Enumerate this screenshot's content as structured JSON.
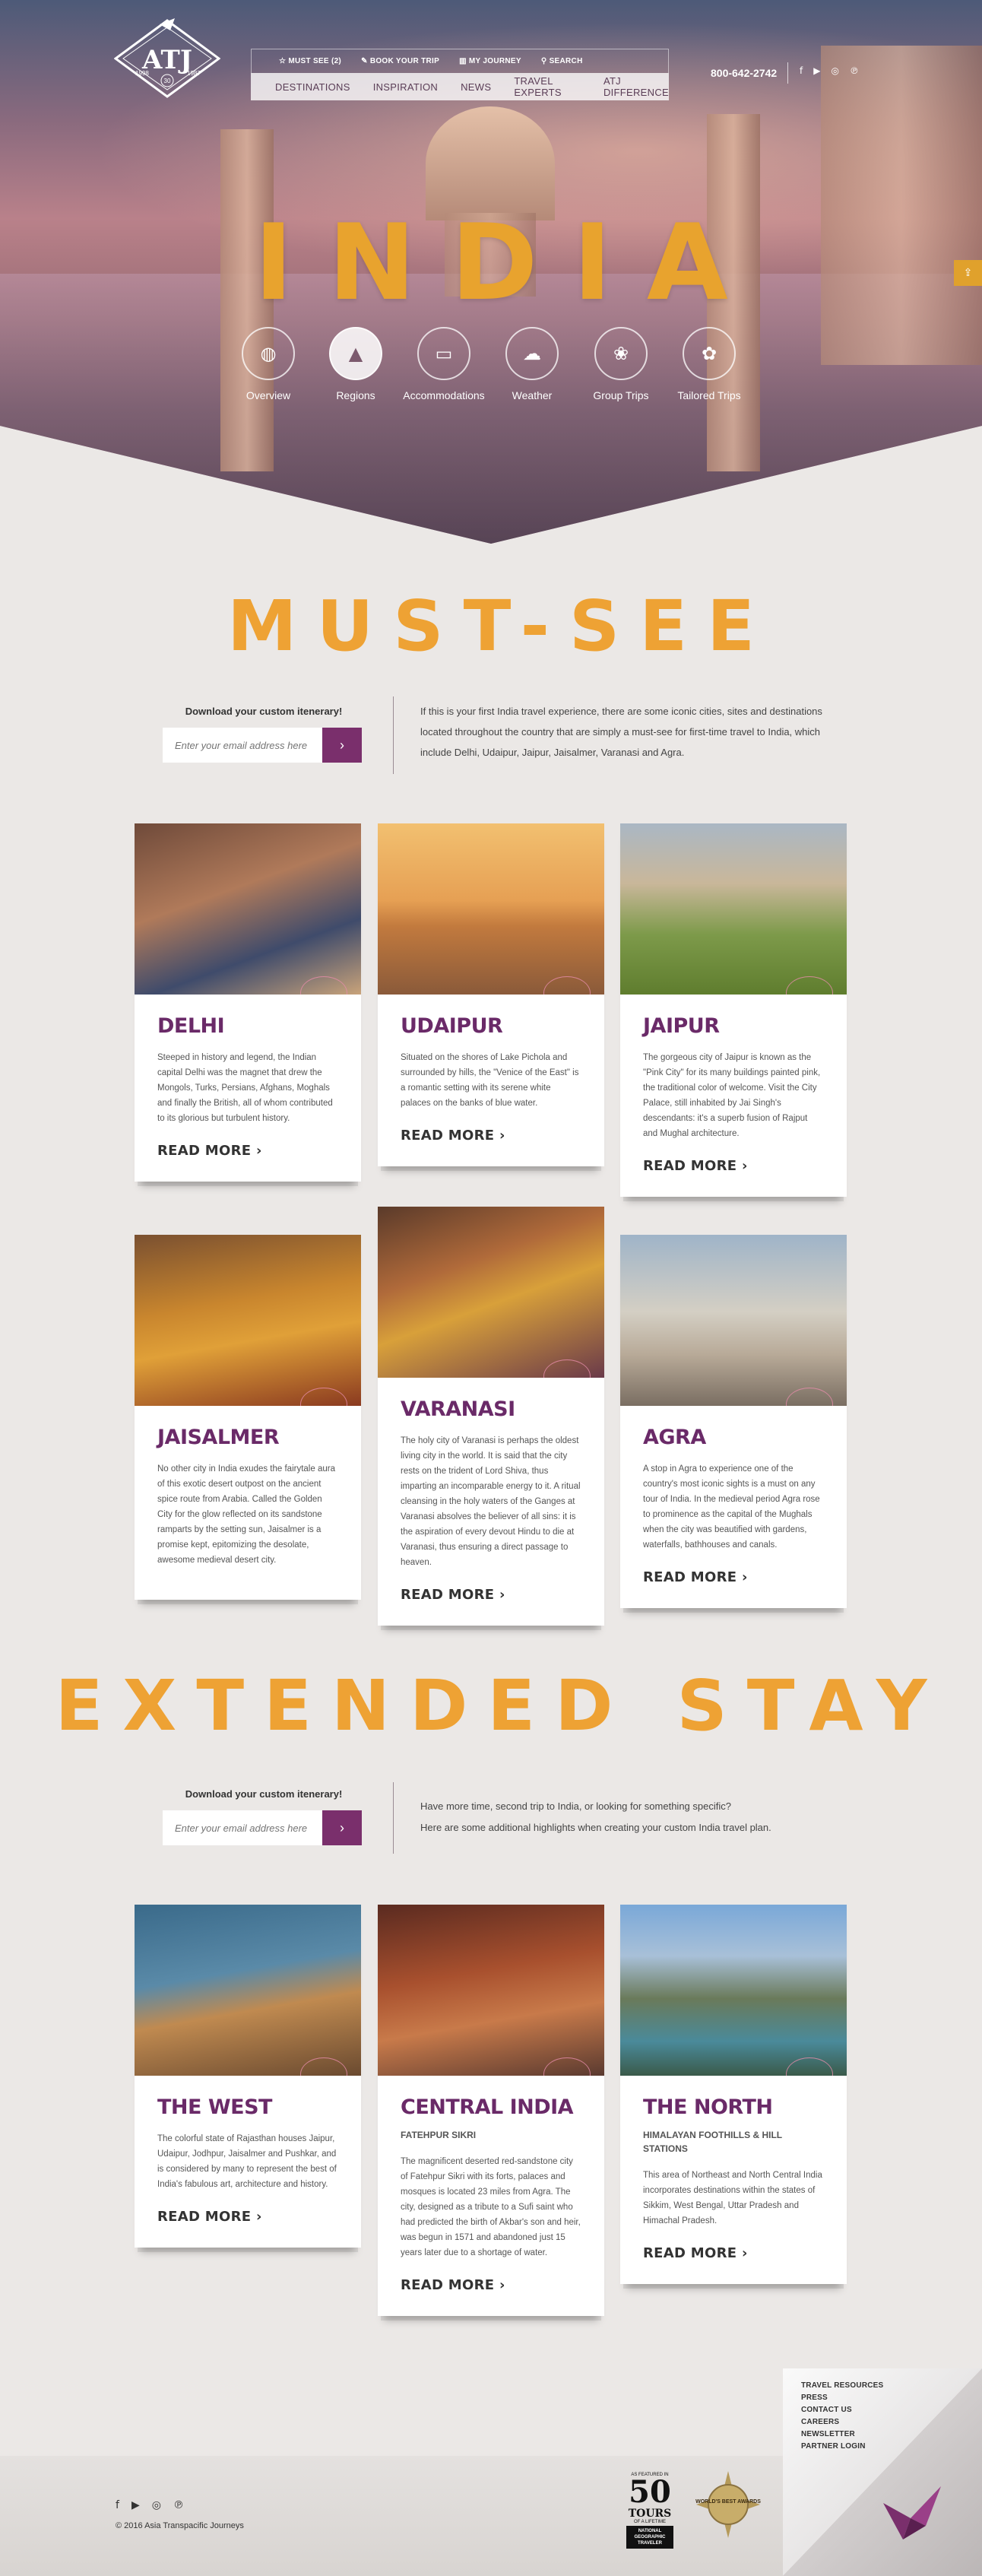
{
  "header": {
    "logo": {
      "word": "ATJ",
      "year_left": "1998",
      "year_right": "1987",
      "badge": "30"
    },
    "top_links": [
      {
        "label": "MUST SEE (2)",
        "icon": "star-icon"
      },
      {
        "label": "BOOK YOUR TRIP",
        "icon": "tag-icon"
      },
      {
        "label": "MY JOURNEY",
        "icon": "book-icon"
      },
      {
        "label": "SEARCH",
        "icon": "search-icon"
      }
    ],
    "main_nav": [
      "DESTINATIONS",
      "INSPIRATION",
      "NEWS",
      "TRAVEL EXPERTS",
      "ATJ DIFFERENCE"
    ],
    "phone": "800-642-2742",
    "social": [
      "f",
      "▶",
      "◎",
      "℗"
    ]
  },
  "hero": {
    "title": "INDIA",
    "categories": [
      {
        "label": "Overview",
        "icon": "globe-icon",
        "glyph": "◍"
      },
      {
        "label": "Regions",
        "icon": "mountain-icon",
        "glyph": "▲"
      },
      {
        "label": "Accommodations",
        "icon": "bed-icon",
        "glyph": "▭"
      },
      {
        "label": "Weather",
        "icon": "cloud-sun-icon",
        "glyph": "☁"
      },
      {
        "label": "Group Trips",
        "icon": "lotus-icon",
        "glyph": "❀"
      },
      {
        "label": "Tailored Trips",
        "icon": "swirl-icon",
        "glyph": "✿"
      }
    ]
  },
  "must_see": {
    "title": "MUST-SEE",
    "download_label": "Download your custom itenerary!",
    "email_placeholder": "Enter your email address here",
    "intro": "If this is your first India travel experience, there are some iconic cities, sites and destinations located throughout the country that are simply a must-see for first-time travel to India, which include Delhi, Udaipur, Jaipur, Jaisalmer, Varanasi and Agra.",
    "cards": [
      {
        "title": "DELHI",
        "text": "Steeped in history and legend, the Indian capital Delhi was the magnet that drew the Mongols, Turks, Persians, Afghans, Moghals and finally the British, all of whom contributed to its glorious but turbulent history.",
        "cta": "READ MORE"
      },
      {
        "title": "UDAIPUR",
        "text": "Situated on the shores of Lake Pichola and surrounded by hills, the \"Venice of the East\" is a romantic setting with its serene white palaces on the banks of blue water.",
        "cta": "READ MORE"
      },
      {
        "title": "JAIPUR",
        "text": "The gorgeous city of Jaipur is known as the \"Pink City\" for its many buildings painted pink, the traditional color of welcome. Visit the City Palace, still inhabited by Jai Singh's descendants: it's a superb fusion of Rajput and Mughal architecture.",
        "cta": "READ MORE"
      },
      {
        "title": "JAISALMER",
        "text": "No other city in India exudes the fairytale aura of this exotic desert outpost on the ancient spice route from Arabia. Called the Golden City for the glow reflected on its sandstone ramparts by the setting sun, Jaisalmer is a promise kept, epitomizing the desolate, awesome medieval desert city.",
        "cta": ""
      },
      {
        "title": "VARANASI",
        "text": "The holy city of Varanasi is perhaps the oldest living city in the world. It is said that the city rests on the trident of Lord Shiva, thus imparting an incomparable energy to it. A ritual cleansing in the holy waters of the Ganges at Varanasi absolves the believer of all sins: it is the aspiration of every devout Hindu to die at Varanasi, thus ensuring a direct passage to heaven.",
        "cta": "READ MORE"
      },
      {
        "title": "AGRA",
        "text": "A stop in Agra to experience one of the country's most iconic sights is a must on any tour of India. In the medieval period Agra rose to prominence as the capital of the Mughals when the city was beautified with gardens, waterfalls, bathhouses and canals.",
        "cta": "READ MORE"
      }
    ]
  },
  "extended": {
    "title": "EXTENDED STAY",
    "download_label": "Download your custom itenerary!",
    "email_placeholder": "Enter your email address here",
    "intro_1": "Have more time, second trip to India, or looking for something specific?",
    "intro_2": "Here are some additional highlights when creating your custom India travel plan.",
    "cards": [
      {
        "title": "THE WEST",
        "sub": "",
        "text": "The colorful state of Rajasthan houses Jaipur, Udaipur, Jodhpur, Jaisalmer and Pushkar, and is considered by many to represent the best of India's fabulous art, architecture and history.",
        "cta": "READ MORE"
      },
      {
        "title": "CENTRAL INDIA",
        "sub": "FATEHPUR SIKRI",
        "text": "The magnificent deserted red-sandstone city of Fatehpur Sikri with its forts, palaces and mosques is located 23 miles from Agra. The city, designed as a tribute to a Sufi saint who had predicted the birth of Akbar's son and heir, was begun in 1571 and abandoned just 15 years later due to a shortage of water.",
        "cta": "READ MORE"
      },
      {
        "title": "THE NORTH",
        "sub": "HIMALAYAN FOOTHILLS & HILL STATIONS",
        "text": "This area of Northeast and North Central India incorporates destinations within the states of Sikkim, West Bengal, Uttar Pradesh and Himachal Pradesh.",
        "cta": "READ MORE"
      }
    ]
  },
  "footer": {
    "social": [
      "f",
      "▶",
      "◎",
      "℗"
    ],
    "copyright": "© 2016 Asia Transpacific Journeys",
    "links": [
      "TRAVEL RESOURCES",
      "PRESS",
      "CONTACT US",
      "CAREERS",
      "NEWSLETTER",
      "PARTNER LOGIN"
    ],
    "badge": {
      "top": "AS FEATURED IN",
      "num": "50",
      "mid": "TOURS",
      "sub": "OF A LIFETIME",
      "brand": "NATIONAL GEOGRAPHIC TRAVELER"
    },
    "award": "WORLD'S BEST AWARDS"
  },
  "colors": {
    "accent": "#eea234",
    "brand": "#7a2f6c",
    "heading": "#6a2a68",
    "bg": "#ebe8e6"
  }
}
